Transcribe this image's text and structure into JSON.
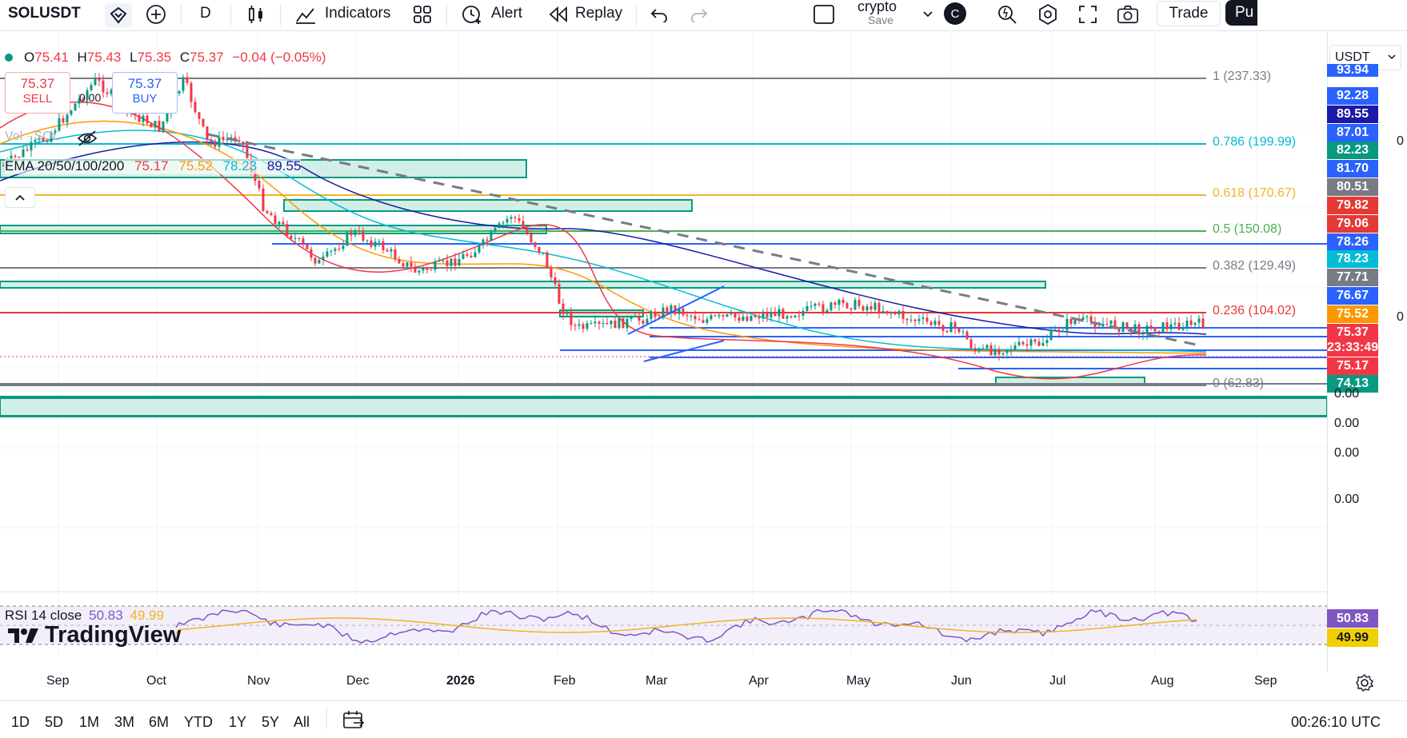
{
  "toolbar": {
    "symbol": "SOLUSDT",
    "interval": "D",
    "indicators_label": "Indicators",
    "alert_label": "Alert",
    "replay_label": "Replay",
    "layout_name": "crypto",
    "layout_save": "Save",
    "avatar_letter": "C",
    "trade_label": "Trade",
    "publish_label": "Pu"
  },
  "ohlc": {
    "o_label": "O",
    "o_value": "75.41",
    "h_label": "H",
    "h_value": "75.43",
    "l_label": "L",
    "l_value": "75.35",
    "c_label": "C",
    "c_value": "75.37",
    "change": "−0.04 (−0.05%)"
  },
  "trade_buttons": {
    "sell_price": "75.37",
    "sell_label": "SELL",
    "spread": "0.00",
    "buy_price": "75.37",
    "buy_label": "BUY"
  },
  "vol_label": "Vol · SOL",
  "ema": {
    "label": "EMA 20/50/100/200",
    "v20": "75.17",
    "v50": "75.52",
    "v100": "78.23",
    "v200": "89.55"
  },
  "currency": "USDT",
  "fib_levels": [
    {
      "label": "1 (237.33)",
      "color": "#787b86"
    },
    {
      "label": "0.786 (199.99)",
      "color": "#00bcd4"
    },
    {
      "label": "0.618 (170.67)",
      "color": "#f0b429"
    },
    {
      "label": "0.5 (150.08)",
      "color": "#4caf50"
    },
    {
      "label": "0.382 (129.49)",
      "color": "#787b86"
    },
    {
      "label": "0.236 (104.02)",
      "color": "#e53935"
    },
    {
      "label": "0 (62.83)",
      "color": "#787b86"
    }
  ],
  "price_axis": {
    "tags": [
      {
        "value": "93.94",
        "color": "#2962ff"
      },
      {
        "value": "92.28",
        "color": "#2962ff"
      },
      {
        "value": "89.55",
        "color": "#1a1aa6"
      },
      {
        "value": "87.01",
        "color": "#2962ff"
      },
      {
        "value": "82.23",
        "color": "#089981"
      },
      {
        "value": "81.70",
        "color": "#2962ff"
      },
      {
        "value": "80.51",
        "color": "#787b86"
      },
      {
        "value": "79.82",
        "color": "#e53935"
      },
      {
        "value": "79.06",
        "color": "#e53935"
      },
      {
        "value": "78.26",
        "color": "#2962ff"
      },
      {
        "value": "78.23",
        "color": "#00bcd4"
      },
      {
        "value": "77.71",
        "color": "#787b86"
      },
      {
        "value": "76.67",
        "color": "#2962ff"
      },
      {
        "value": "75.52",
        "color": "#ff9800"
      },
      {
        "value": "75.37",
        "color": "#f23645"
      },
      {
        "value": "23:33:49",
        "color": "#f23645"
      },
      {
        "value": "75.17",
        "color": "#f23645"
      },
      {
        "value": "74.13",
        "color": "#089981"
      }
    ],
    "zeros": [
      "0.00",
      "0.00",
      "0.00",
      "0.00"
    ],
    "right_edge_digits": [
      "0",
      "0"
    ]
  },
  "rsi": {
    "label": "RSI 14 close",
    "value": "50.83",
    "ma_value": "49.99"
  },
  "brand": "TradingView",
  "time_axis": [
    "Sep",
    "Oct",
    "Nov",
    "Dec",
    "2026",
    "Feb",
    "Mar",
    "Apr",
    "May",
    "Jun",
    "Jul",
    "Aug",
    "Sep"
  ],
  "ranges": [
    "1D",
    "5D",
    "1M",
    "3M",
    "6M",
    "YTD",
    "1Y",
    "5Y",
    "All"
  ],
  "clock": "00:26:10 UTC",
  "colors": {
    "up": "#089981",
    "down": "#f23645",
    "zone_fill": "#d1efe6",
    "zone_border": "#089981",
    "trend": "#2962ff"
  }
}
